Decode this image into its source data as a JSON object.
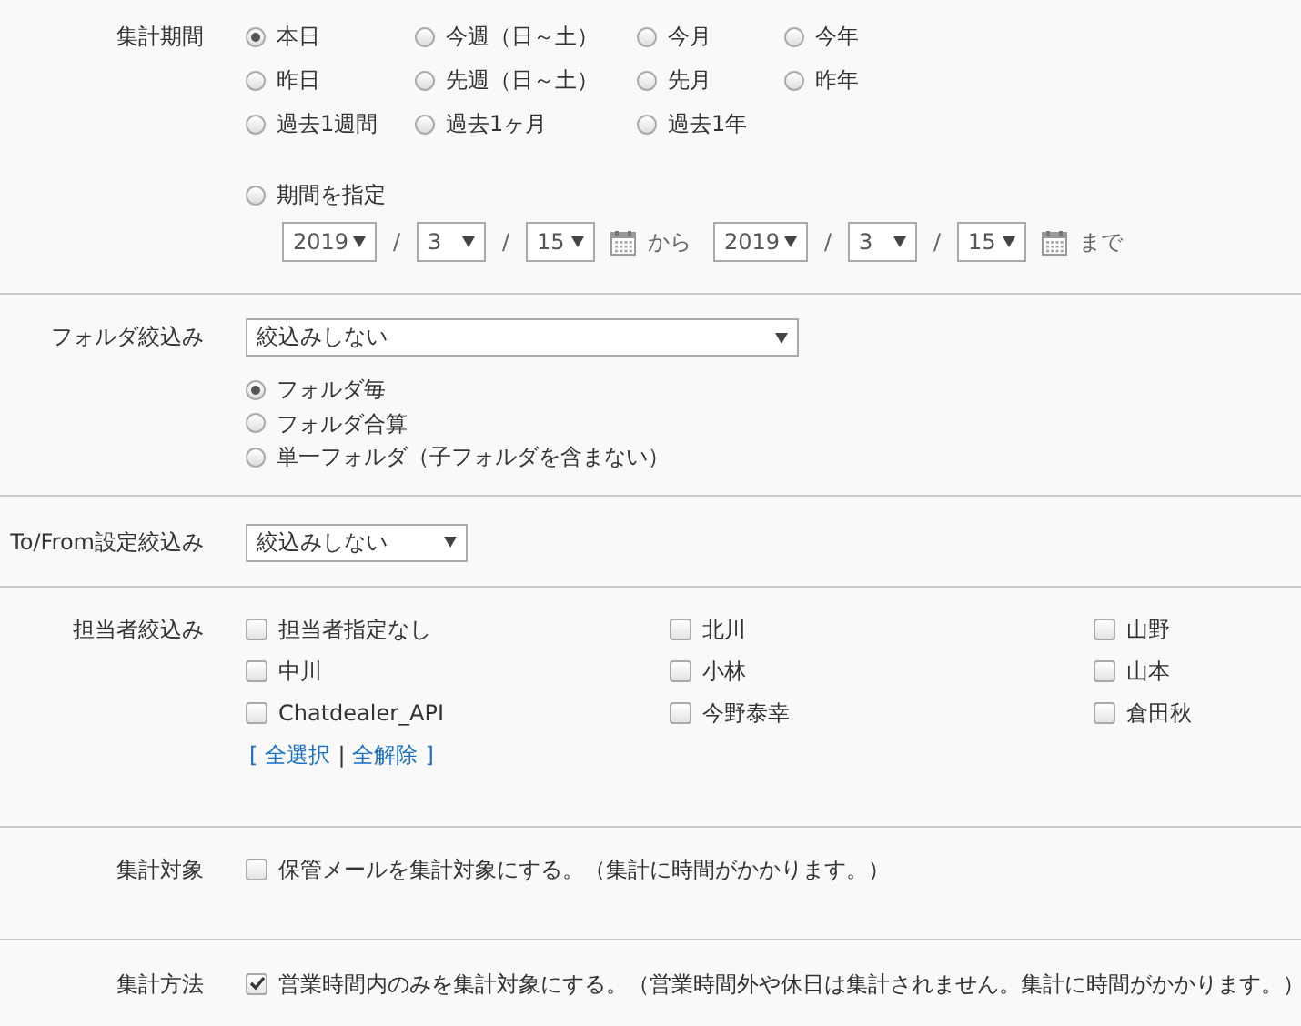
{
  "sections": [
    {
      "kind": "period",
      "label": "集計期間",
      "options": [
        {
          "label": "本日",
          "selected": true
        },
        {
          "label": "今週（日～土）",
          "selected": false
        },
        {
          "label": "今月",
          "selected": false
        },
        {
          "label": "今年",
          "selected": false
        },
        {
          "label": "昨日",
          "selected": false
        },
        {
          "label": "先週（日～土）",
          "selected": false
        },
        {
          "label": "先月",
          "selected": false
        },
        {
          "label": "昨年",
          "selected": false
        },
        {
          "label": "過去1週間",
          "selected": false
        },
        {
          "label": "過去1ヶ月",
          "selected": false
        },
        {
          "label": "過去1年",
          "selected": false
        }
      ],
      "custom_range": {
        "label": "期間を指定",
        "selected": false,
        "from": {
          "year": "2019",
          "month": "3",
          "day": "15",
          "separators": [
            "/",
            "/"
          ]
        },
        "from_suffix": "から",
        "to": {
          "year": "2019",
          "month": "3",
          "day": "15",
          "separators": [
            "/",
            "/"
          ]
        },
        "to_suffix": "まで"
      }
    },
    {
      "kind": "folder",
      "label": "フォルダ絞込み",
      "select": {
        "value": "絞込みしない"
      },
      "options": [
        {
          "label": "フォルダ毎",
          "selected": true
        },
        {
          "label": "フォルダ合算",
          "selected": false
        },
        {
          "label": "単一フォルダ（子フォルダを含まない）",
          "selected": false
        }
      ]
    },
    {
      "kind": "select",
      "label": "To/From設定絞込み",
      "select": {
        "value": "絞込みしない"
      }
    },
    {
      "kind": "checkgrid",
      "label": "担当者絞込み",
      "options": [
        {
          "label": "担当者指定なし",
          "checked": false
        },
        {
          "label": "北川",
          "checked": false
        },
        {
          "label": "山野",
          "checked": false
        },
        {
          "label": "中川",
          "checked": false
        },
        {
          "label": "小林",
          "checked": false
        },
        {
          "label": "山本",
          "checked": false
        },
        {
          "label": "Chatdealer_API",
          "checked": false
        },
        {
          "label": "今野泰幸",
          "checked": false
        },
        {
          "label": "倉田秋",
          "checked": false
        }
      ],
      "link_bar": {
        "open": "[",
        "links": [
          "全選択",
          "全解除"
        ],
        "separator": "|",
        "close": "]"
      }
    },
    {
      "kind": "checkbox",
      "label": "集計対象",
      "option": {
        "label": "保管メールを集計対象にする。（集計に時間がかかります。）",
        "checked": false
      }
    },
    {
      "kind": "checkbox",
      "label": "集計方法",
      "option": {
        "label": "営業時間内のみを集計対象にする。（営業時間外や休日は集計されません。集計に時間がかかります。）",
        "checked": true
      }
    }
  ]
}
